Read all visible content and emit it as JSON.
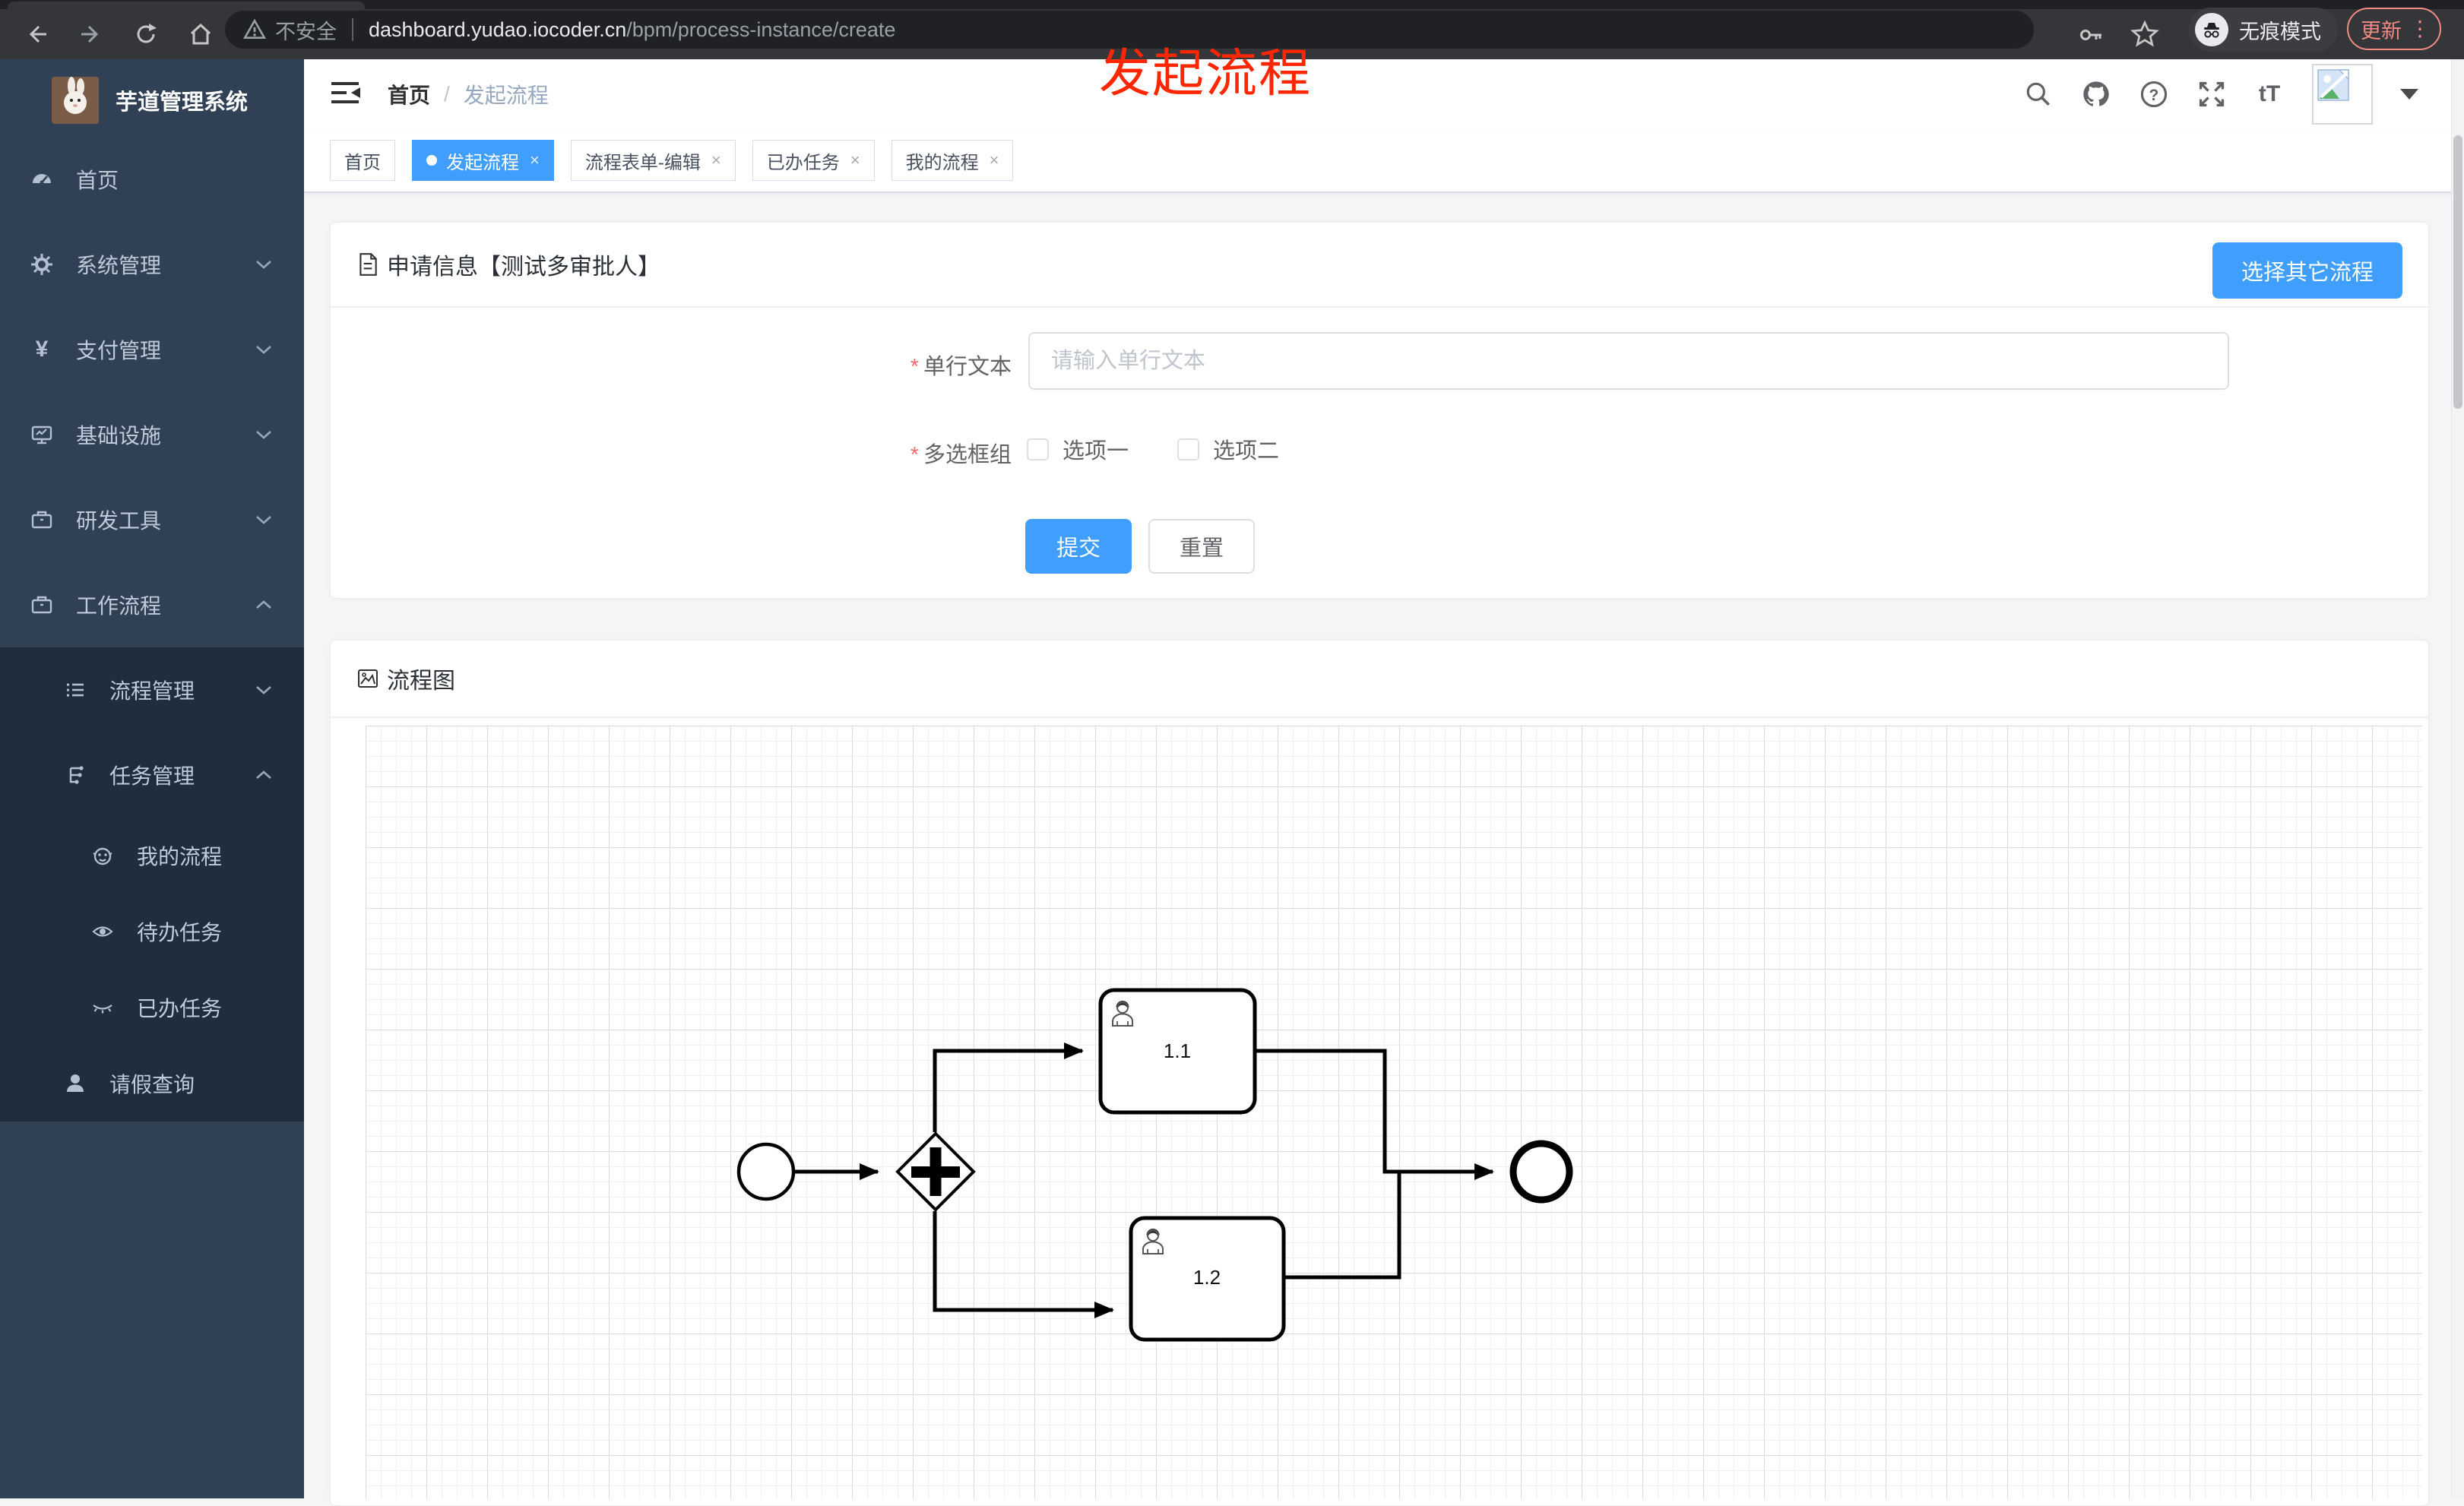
{
  "browser": {
    "security_label": "不安全",
    "url_domain": "dashboard.yudao.iocoder.cn",
    "url_path": "/bpm/process-instance/create",
    "incognito_label": "无痕模式",
    "update_label": "更新",
    "more_glyph": "⋮"
  },
  "sidebar": {
    "title": "芋道管理系统",
    "items": [
      {
        "label": "首页"
      },
      {
        "label": "系统管理"
      },
      {
        "label": "支付管理"
      },
      {
        "label": "基础设施"
      },
      {
        "label": "研发工具"
      },
      {
        "label": "工作流程"
      }
    ],
    "submenu": {
      "items": [
        {
          "label": "流程管理"
        },
        {
          "label": "任务管理"
        }
      ],
      "task_children": [
        {
          "label": "我的流程"
        },
        {
          "label": "待办任务"
        },
        {
          "label": "已办任务"
        }
      ],
      "leave_query": {
        "label": "请假查询"
      }
    }
  },
  "header": {
    "breadcrumb": {
      "home": "首页",
      "separator": "/",
      "current": "发起流程"
    },
    "font_size_glyph": "tT",
    "help_glyph": "?"
  },
  "annotation": {
    "text": "发起流程",
    "color": "#ff2600"
  },
  "ui": {
    "close_glyph": "×",
    "required_mark": "*",
    "yen_glyph": "¥"
  },
  "tags": [
    {
      "label": "首页"
    },
    {
      "label": "发起流程"
    },
    {
      "label": "流程表单-编辑"
    },
    {
      "label": "已办任务"
    },
    {
      "label": "我的流程"
    }
  ],
  "apply_panel": {
    "title": "申请信息【测试多审批人】",
    "select_other_button": "选择其它流程",
    "text_field": {
      "label": "单行文本",
      "required": true,
      "placeholder": "请输入单行文本",
      "value": ""
    },
    "checkbox_group": {
      "label": "多选框组",
      "required": true,
      "options": [
        {
          "label": "选项一",
          "checked": false
        },
        {
          "label": "选项二",
          "checked": false
        }
      ]
    },
    "submit_button": "提交",
    "reset_button": "重置"
  },
  "diagram_panel": {
    "title": "流程图",
    "nodes": {
      "start": {
        "type": "start-event"
      },
      "gateway": {
        "type": "parallel-gateway"
      },
      "tasks": [
        {
          "label": "1.1",
          "type": "user-task"
        },
        {
          "label": "1.2",
          "type": "user-task"
        }
      ],
      "end": {
        "type": "end-event"
      }
    }
  },
  "colors": {
    "accent": "#409eff",
    "sidebar_bg": "#304156",
    "sidebar_submenu_bg": "#1f2d3d",
    "annotation_red": "#ff2600",
    "chrome_bar": "#35363a",
    "update_salmon": "#f28b82"
  }
}
